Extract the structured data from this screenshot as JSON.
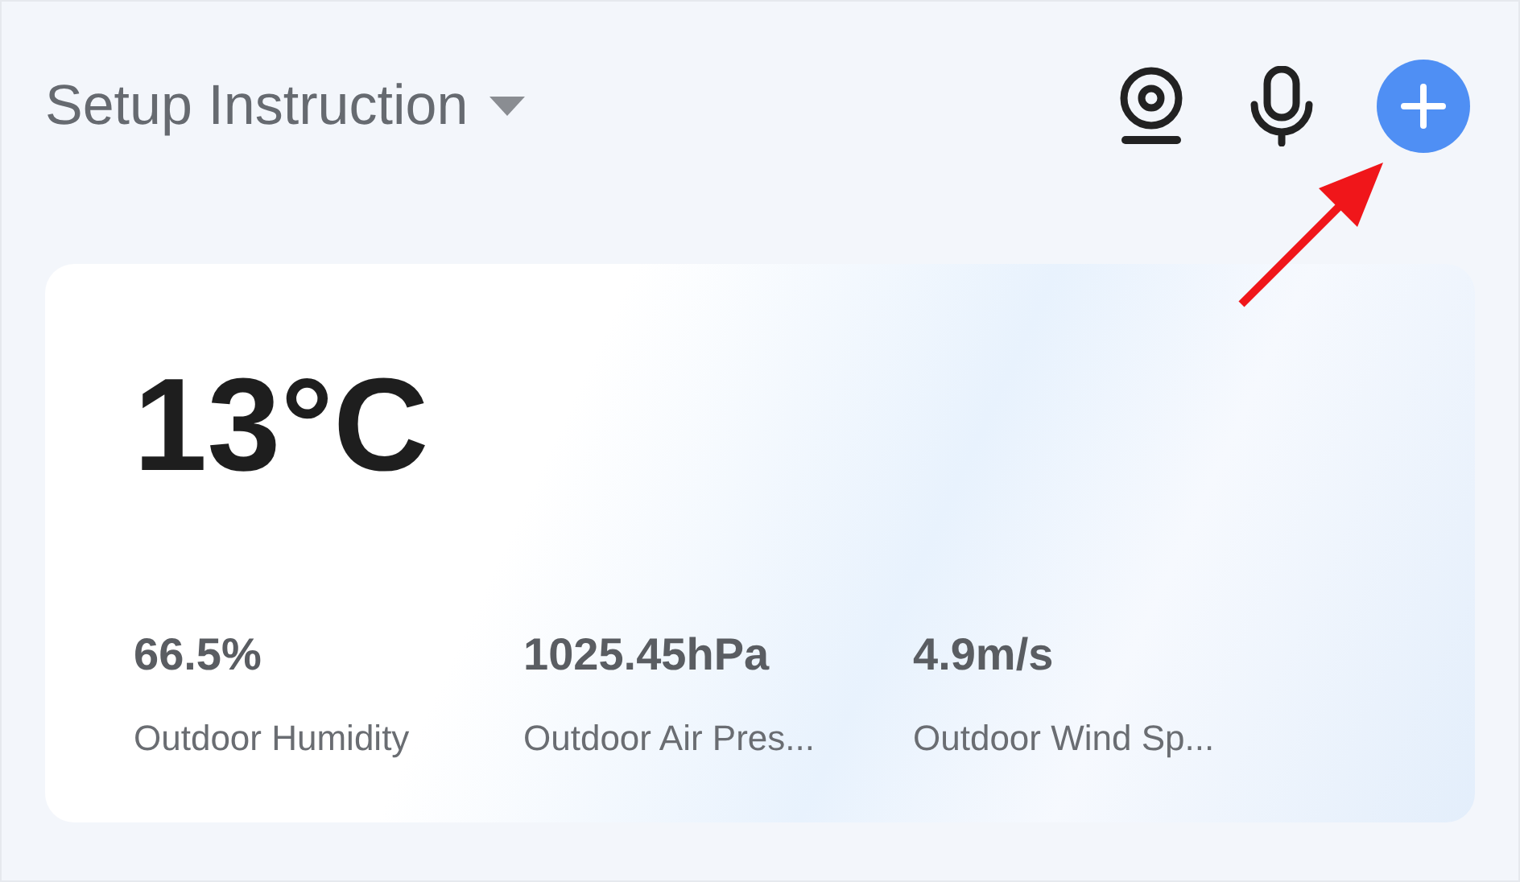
{
  "header": {
    "title": "Setup Instruction"
  },
  "weather": {
    "temperature": "13°C",
    "stats": [
      {
        "value": "66.5%",
        "label": "Outdoor Humidity"
      },
      {
        "value": "1025.45hPa",
        "label": "Outdoor Air Pres..."
      },
      {
        "value": "4.9m/s",
        "label": "Outdoor Wind Sp..."
      }
    ]
  }
}
